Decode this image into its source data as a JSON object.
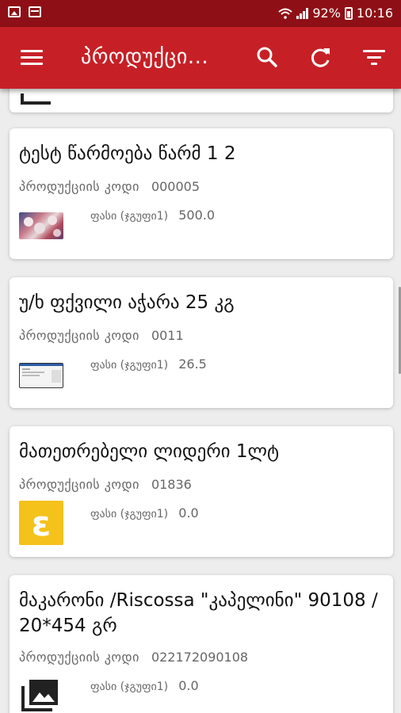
{
  "status_bar": {
    "battery": "92%",
    "time": "10:16"
  },
  "app_bar": {
    "title": "პროდუქცი..."
  },
  "products": [
    {
      "name": "ტესტ წარმოება წარმ 1 2",
      "code_label": "პროდუქციის კოდი",
      "code": "000005",
      "price_label": "ფასი (ჯგუფი1)",
      "price": "500.0",
      "thumb": "photo"
    },
    {
      "name": "უ/ხ ფქვილი აჭარა 25 კგ",
      "code_label": "პროდუქციის კოდი",
      "code": "0011",
      "price_label": "ფასი (ჯგუფი1)",
      "price": "26.5",
      "thumb": "screenshot"
    },
    {
      "name": "მათეთრებელი ლიდერი 1ლტ",
      "code_label": "პროდუქციის კოდი",
      "code": "01836",
      "price_label": "ფასი (ჯგუფი1)",
      "price": "0.0",
      "thumb": "logo-yellow"
    },
    {
      "name": "მაკარონი /Riscossa \"კაპელინი\" 90108 / 20*454 გრ",
      "code_label": "პროდუქციის კოდი",
      "code": "022172090108",
      "price_label": "ფასი (ჯგუფი1)",
      "price": "0.0",
      "thumb": "image-placeholder-icon"
    }
  ],
  "colors": {
    "app_bar": "#c62026",
    "status_bar": "#8e1016",
    "background": "#ededed"
  }
}
